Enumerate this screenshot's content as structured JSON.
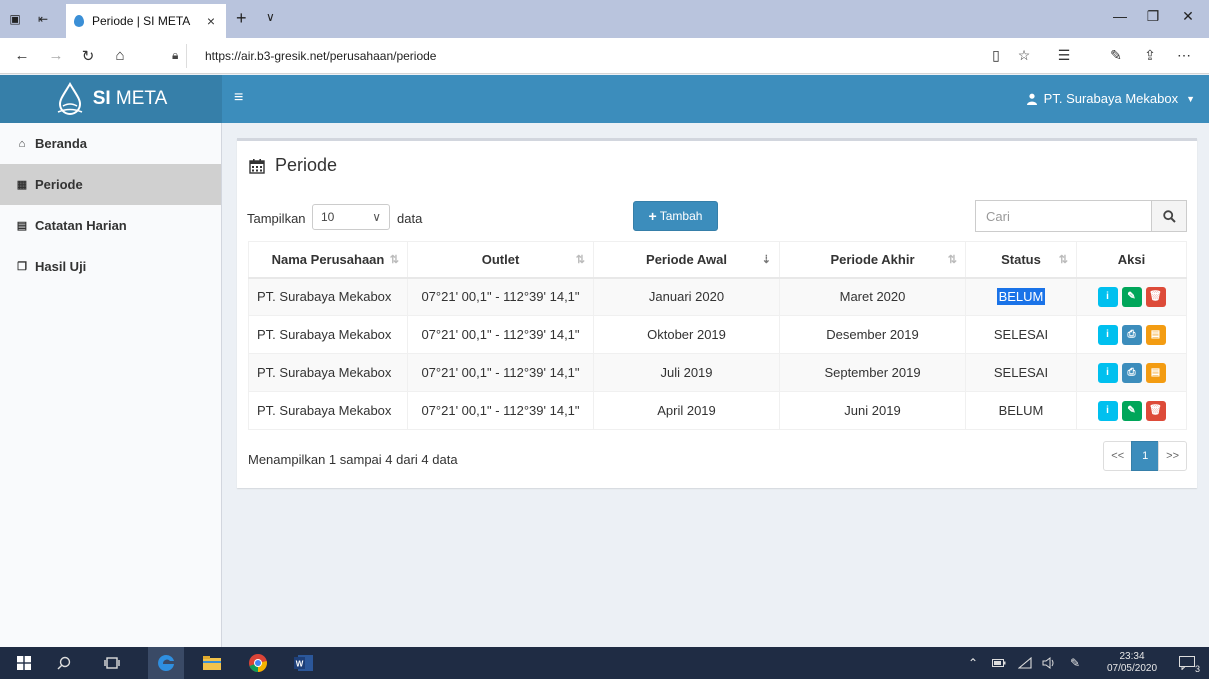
{
  "browser": {
    "tab_title": "Periode | SI META",
    "tab_close": "×",
    "new_tab": "+",
    "tab_dropdown": "∨",
    "url": "https://air.b3-gresik.net/perusahaan/periode",
    "window_minimize": "—",
    "window_restore": "❐",
    "window_close": "✕"
  },
  "header": {
    "brand_bold": "SI",
    "brand_rest": " META",
    "menu_toggle": "≡",
    "user_name": "PT. Surabaya Mekabox",
    "user_caret": "▼",
    "accent_color": "#3c8dbc"
  },
  "sidebar": {
    "items": [
      {
        "label": "Beranda",
        "icon": "home-icon"
      },
      {
        "label": "Periode",
        "icon": "calendar-icon",
        "active": true
      },
      {
        "label": "Catatan Harian",
        "icon": "file-icon"
      },
      {
        "label": "Hasil Uji",
        "icon": "files-icon"
      }
    ]
  },
  "page": {
    "title": "Periode",
    "length_label": "Tampilkan",
    "length_value": "10",
    "length_suffix": "data",
    "add_button": "Tambah",
    "search_placeholder": "Cari",
    "info": "Menampilkan 1 sampai 4 dari 4 data",
    "pager": {
      "prev": "<<",
      "current": "1",
      "next": ">>"
    }
  },
  "table": {
    "columns": [
      "Nama Perusahaan",
      "Outlet",
      "Periode Awal",
      "Periode Akhir",
      "Status",
      "Aksi"
    ],
    "rows": [
      {
        "company": "PT. Surabaya Mekabox",
        "outlet": "07°21' 00,1\" - 112°39' 14,1\"",
        "start": "Januari 2020",
        "end": "Maret 2020",
        "status": "BELUM",
        "actions": [
          "info",
          "edit",
          "delete"
        ]
      },
      {
        "company": "PT. Surabaya Mekabox",
        "outlet": "07°21' 00,1\" - 112°39' 14,1\"",
        "start": "Oktober 2019",
        "end": "Desember 2019",
        "status": "SELESAI",
        "actions": [
          "info",
          "print",
          "file"
        ]
      },
      {
        "company": "PT. Surabaya Mekabox",
        "outlet": "07°21' 00,1\" - 112°39' 14,1\"",
        "start": "Juli 2019",
        "end": "September 2019",
        "status": "SELESAI",
        "actions": [
          "info",
          "print",
          "file"
        ]
      },
      {
        "company": "PT. Surabaya Mekabox",
        "outlet": "07°21' 00,1\" - 112°39' 14,1\"",
        "start": "April 2019",
        "end": "Juni 2019",
        "status": "BELUM",
        "actions": [
          "info",
          "edit",
          "delete"
        ]
      }
    ]
  },
  "taskbar": {
    "time": "23:34",
    "date": "07/05/2020",
    "notification_count": "3"
  }
}
